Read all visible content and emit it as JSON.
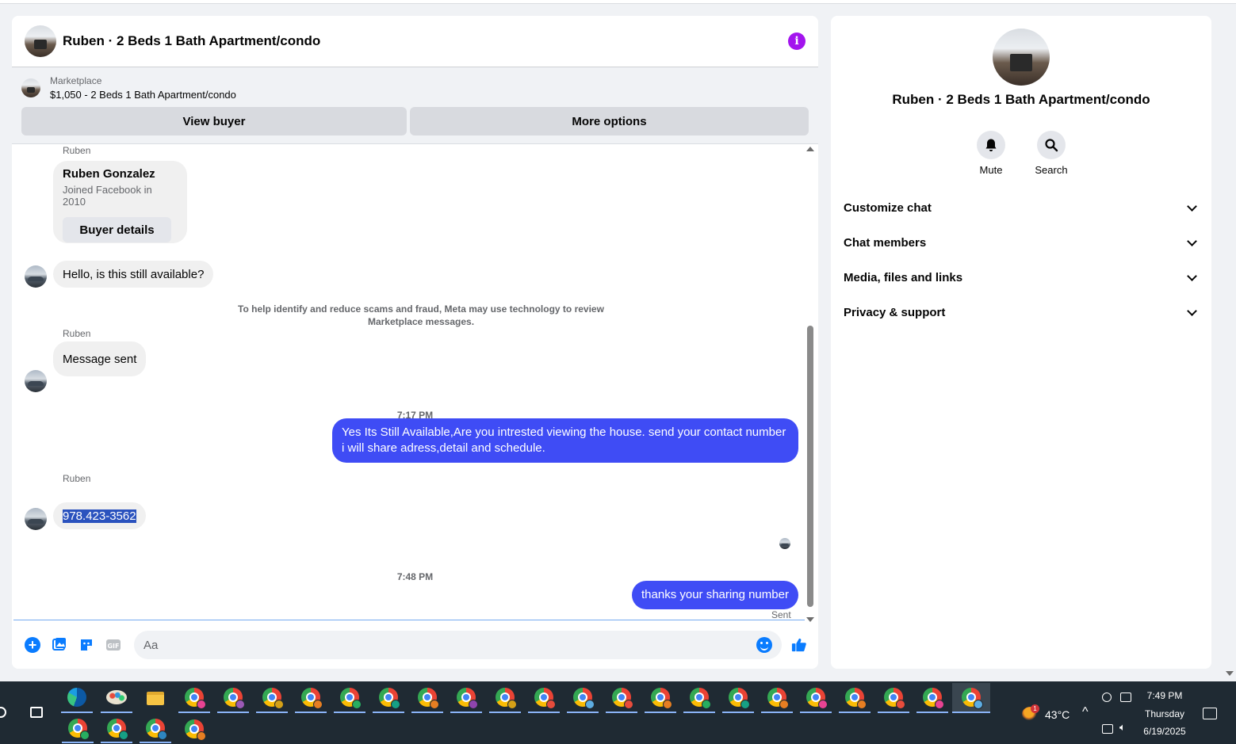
{
  "header": {
    "title": "Ruben · 2 Beds 1 Bath Apartment/condo",
    "info_icon": "i"
  },
  "marketplace": {
    "label": "Marketplace",
    "listing": "$1,050 - 2 Beds 1 Bath Apartment/condo",
    "view_buyer": "View buyer",
    "more_options": "More options"
  },
  "messages": {
    "sender_name": "Ruben",
    "buyer_card": {
      "name": "Ruben Gonzalez",
      "joined": "Joined Facebook in 2010",
      "button": "Buyer details"
    },
    "greeting": "Hello, is this still available?",
    "notice": "To help identify and reduce scams and fraud, Meta may use technology to review Marketplace messages.",
    "message_sent": "Message sent",
    "time1": "7:17 PM",
    "reply1": "Yes Its Still Available,Are you intrested viewing the house. send your contact number i will share adress,detail and schedule.",
    "phone": "978.423-3562",
    "time2": "7:48 PM",
    "reply2": "thanks your sharing number",
    "sent_status": "Sent"
  },
  "composer": {
    "placeholder": "Aa",
    "gif_label": "GIF"
  },
  "side": {
    "title": "Ruben · 2 Beds 1 Bath Apartment/condo",
    "mute": "Mute",
    "search": "Search",
    "rows": [
      "Customize chat",
      "Chat members",
      "Media, files and links",
      "Privacy & support"
    ]
  },
  "taskbar": {
    "weather_badge": "1",
    "temperature": "43°C",
    "time": "7:49 PM",
    "day": "Thursday",
    "date": "6/19/2025"
  },
  "colors": {
    "outgoing_bubble": "#3f4cf5",
    "accent": "#0a7cff",
    "info_purple": "#a314ee",
    "taskbar_bg": "#1f2a33"
  }
}
